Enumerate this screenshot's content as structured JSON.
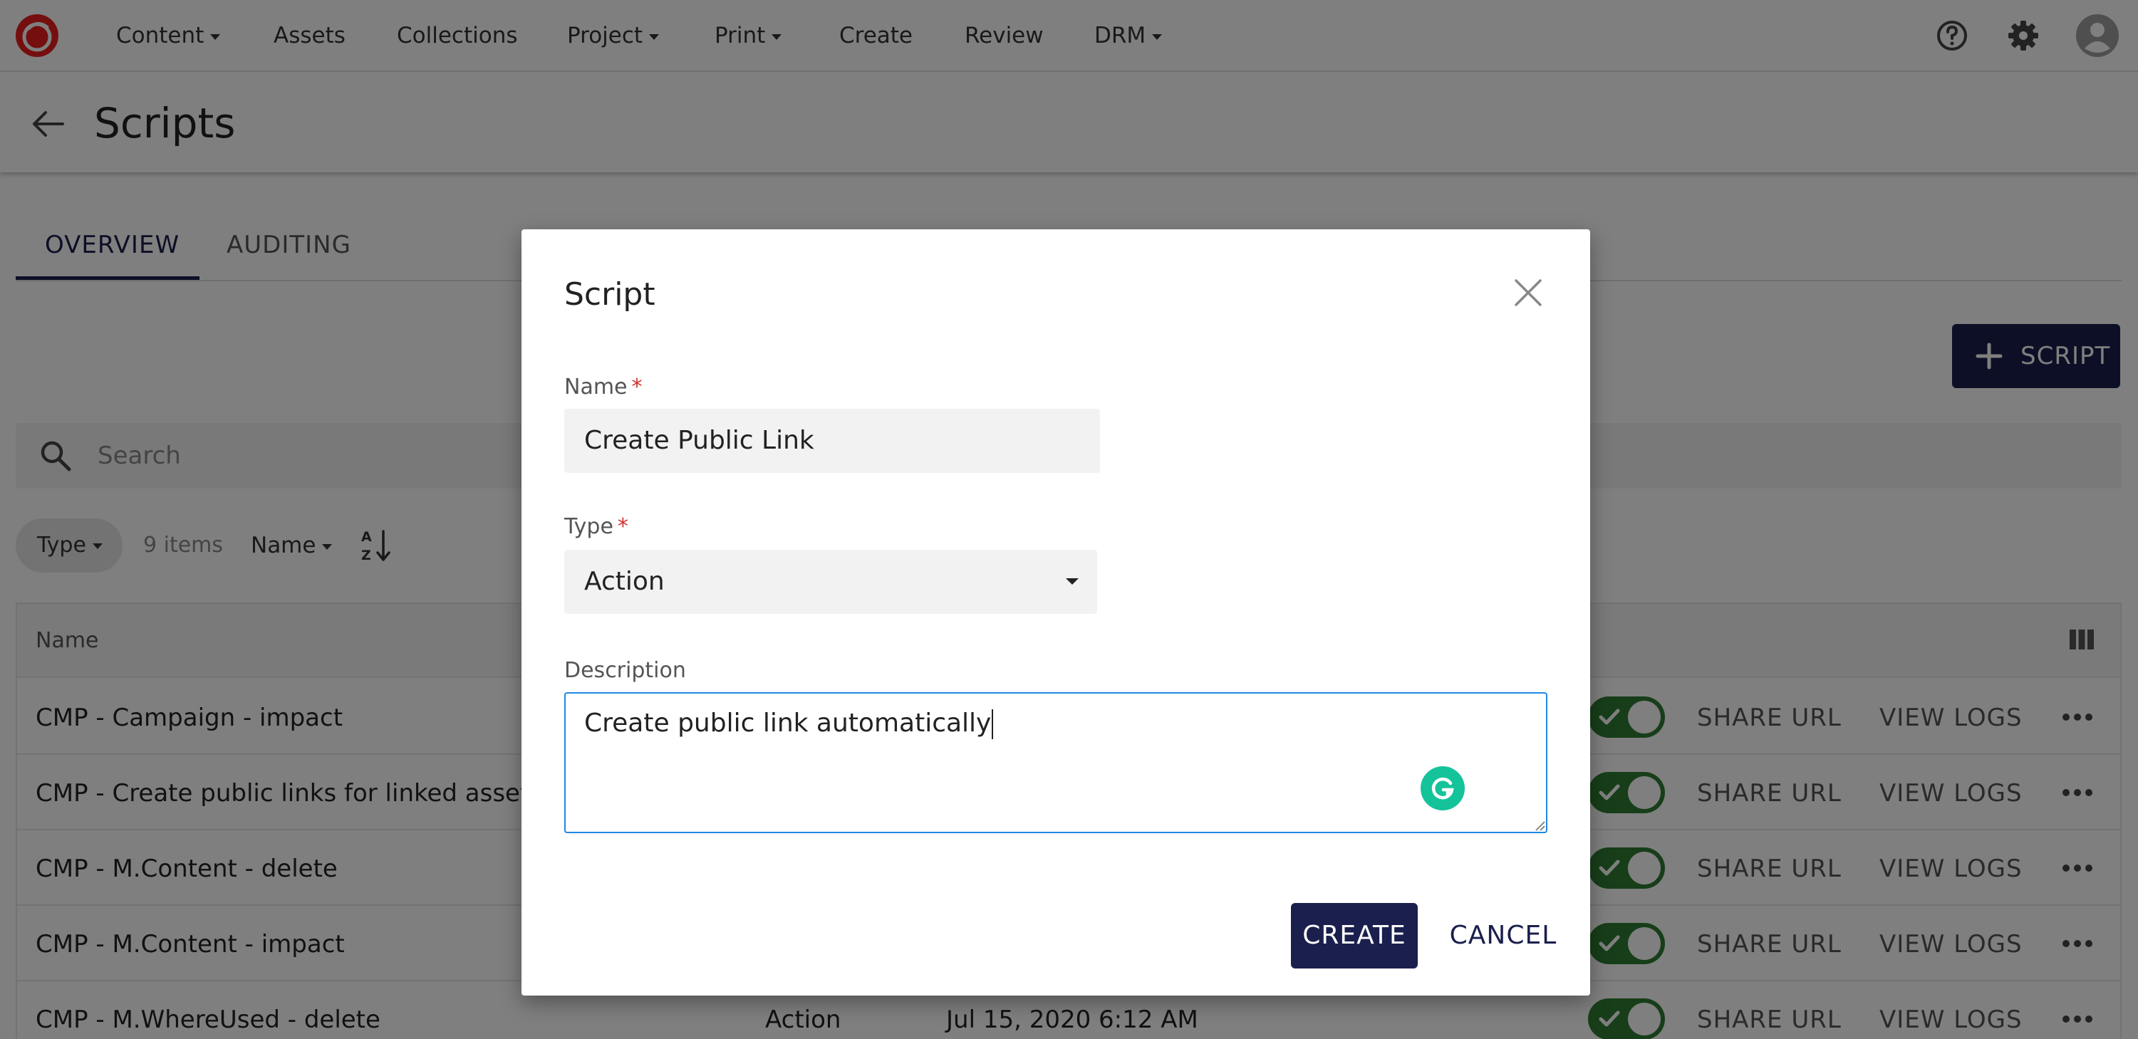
{
  "topnav": {
    "items": [
      {
        "label": "Content",
        "dropdown": true
      },
      {
        "label": "Assets",
        "dropdown": false
      },
      {
        "label": "Collections",
        "dropdown": false
      },
      {
        "label": "Project",
        "dropdown": true
      },
      {
        "label": "Print",
        "dropdown": true
      },
      {
        "label": "Create",
        "dropdown": false
      },
      {
        "label": "Review",
        "dropdown": false
      },
      {
        "label": "DRM",
        "dropdown": true
      }
    ],
    "icons": [
      "help-icon",
      "settings-icon",
      "user-avatar-icon"
    ]
  },
  "page": {
    "title": "Scripts"
  },
  "tabs": [
    {
      "label": "OVERVIEW",
      "active": true
    },
    {
      "label": "AUDITING",
      "active": false
    }
  ],
  "toolbar": {
    "add_label": "SCRIPT",
    "search_placeholder": "Search",
    "type_filter": "Type",
    "items_count": "9 items",
    "sort_field": "Name"
  },
  "table": {
    "columns": [
      "Name"
    ],
    "rows": [
      {
        "name": "CMP - Campaign - impact",
        "type": "",
        "date": "",
        "enabled": true,
        "share": "SHARE URL",
        "logs": "VIEW LOGS"
      },
      {
        "name": "CMP - Create public links for linked assets",
        "type": "",
        "date": "",
        "enabled": true,
        "share": "SHARE URL",
        "logs": "VIEW LOGS"
      },
      {
        "name": "CMP - M.Content - delete",
        "type": "",
        "date": "",
        "enabled": true,
        "share": "SHARE URL",
        "logs": "VIEW LOGS"
      },
      {
        "name": "CMP - M.Content - impact",
        "type": "",
        "date": "",
        "enabled": true,
        "share": "SHARE URL",
        "logs": "VIEW LOGS"
      },
      {
        "name": "CMP - M.WhereUsed - delete",
        "type": "Action",
        "date": "Jul 15, 2020 6:12 AM",
        "enabled": true,
        "share": "SHARE URL",
        "logs": "VIEW LOGS"
      }
    ]
  },
  "dialog": {
    "title": "Script",
    "name_label": "Name",
    "name_value": "Create Public Link",
    "type_label": "Type",
    "type_value": "Action",
    "description_label": "Description",
    "description_value": "Create public link automatically",
    "required_mark": "*",
    "create_label": "CREATE",
    "cancel_label": "CANCEL"
  },
  "colors": {
    "primary": "#1a1f4d",
    "toggle_on": "#2e7d32",
    "focus": "#1e88e5",
    "required": "#d32f2f",
    "grammarly": "#15c39a"
  }
}
